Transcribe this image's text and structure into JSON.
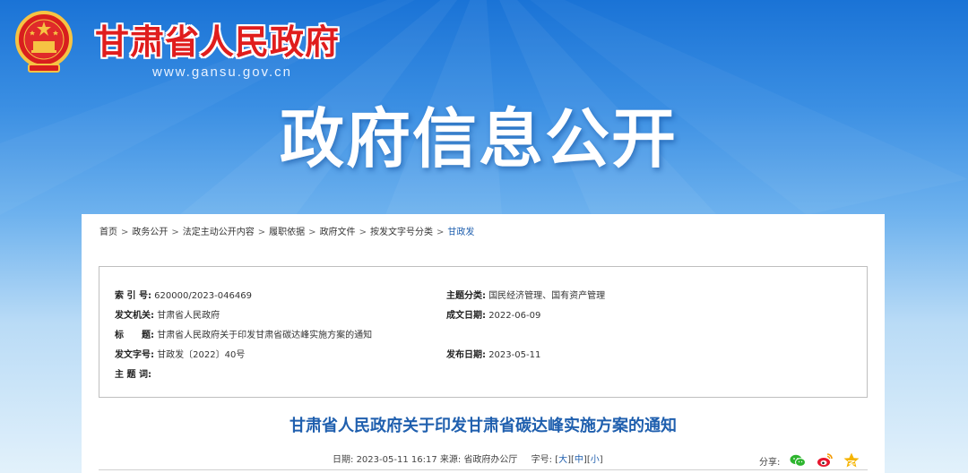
{
  "header": {
    "site_name": "甘肃省人民政府",
    "site_url": "www.gansu.gov.cn",
    "section_title": "政府信息公开"
  },
  "breadcrumb": [
    {
      "label": "首页"
    },
    {
      "label": "政务公开"
    },
    {
      "label": "法定主动公开内容"
    },
    {
      "label": "履职依据"
    },
    {
      "label": "政府文件"
    },
    {
      "label": "按发文字号分类"
    },
    {
      "label": "甘政发"
    }
  ],
  "breadcrumb_separator": ">",
  "info": {
    "index_label": "索 引 号:",
    "index_value": "620000/2023-046469",
    "topic_label": "主题分类:",
    "topic_value": "国民经济管理、国有资产管理",
    "issuer_label": "发文机关:",
    "issuer_value": "甘肃省人民政府",
    "date_label": "成文日期:",
    "date_value": "2022-06-09",
    "title_label": "标　　题:",
    "title_value": "甘肃省人民政府关于印发甘肃省碳达峰实施方案的通知",
    "docno_label": "发文字号:",
    "docno_value": "甘政发〔2022〕40号",
    "publish_label": "发布日期:",
    "publish_value": "2023-05-11",
    "keywords_label": "主 题 词:",
    "keywords_value": ""
  },
  "article": {
    "title": "甘肃省人民政府关于印发甘肃省碳达峰实施方案的通知",
    "date_label": "日期:",
    "date_value": "2023-05-11 16:17",
    "source_label": "来源:",
    "source_value": "省政府办公厅",
    "fontsize_label": "字号:",
    "size_large": "大",
    "size_medium": "中",
    "size_small": "小",
    "share_label": "分享:"
  },
  "colors": {
    "brand_red": "#e01d1d",
    "link_blue": "#1f5fae",
    "wechat_green": "#2db52e",
    "weibo_red": "#e6162d",
    "star_yellow": "#f5b400"
  },
  "icons": [
    "national-emblem-icon",
    "wechat-icon",
    "weibo-icon",
    "qzone-star-icon"
  ]
}
